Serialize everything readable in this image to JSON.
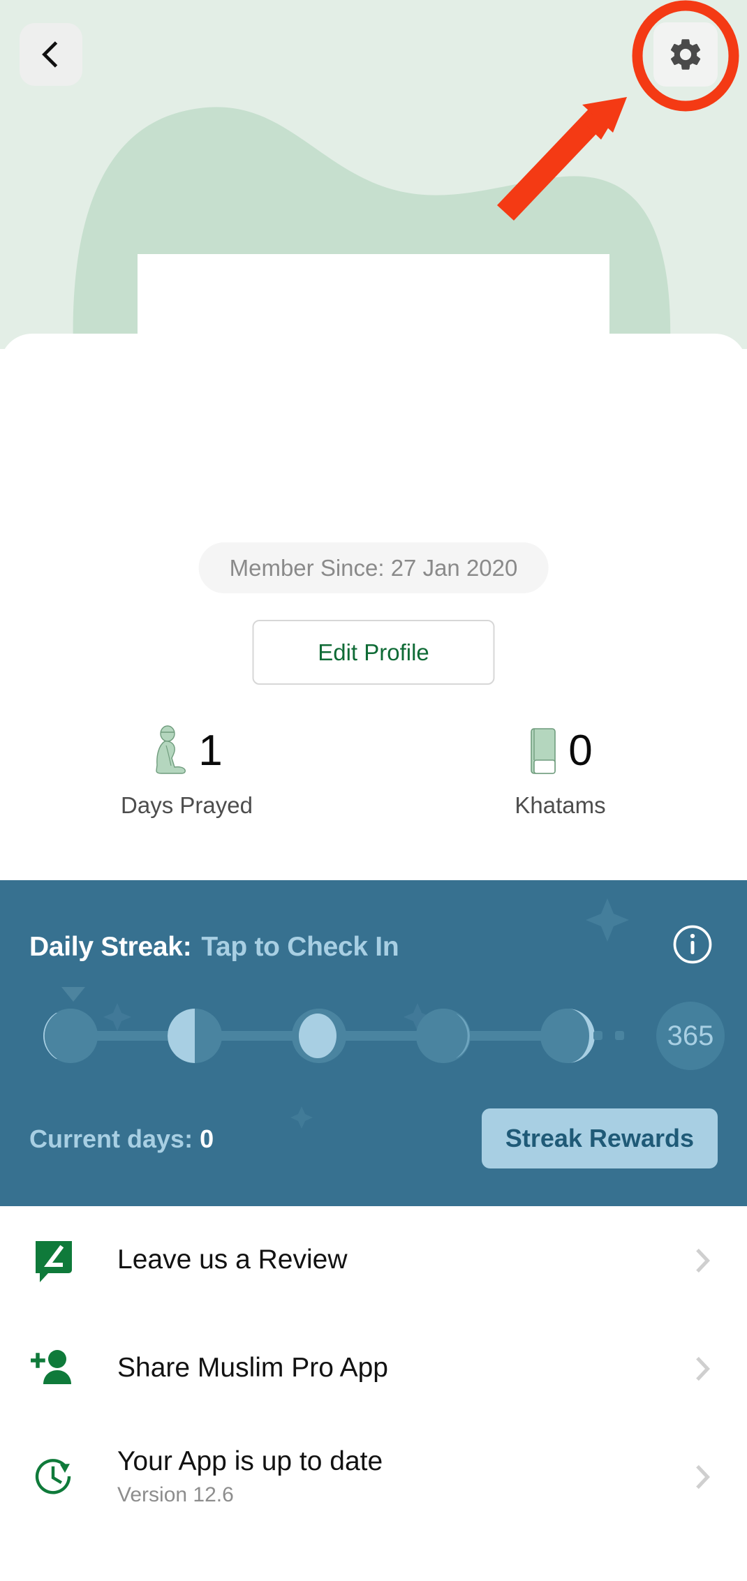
{
  "header": {
    "back_icon": "chevron-left-icon",
    "settings_icon": "gear-icon",
    "annotation": {
      "highlight_icon": "red-circle-annotation",
      "arrow_icon": "red-arrow-annotation",
      "color": "#f43a14"
    },
    "bg_color": "#e3eee6",
    "blob_color": "#c6dfce"
  },
  "profile": {
    "member_since": "Member Since: 27 Jan 2020",
    "edit_profile_label": "Edit Profile",
    "edit_profile_color": "#0f6b36"
  },
  "stats": [
    {
      "icon": "praying-person-icon",
      "value": "1",
      "label": "Days Prayed"
    },
    {
      "icon": "quran-book-icon",
      "value": "0",
      "label": "Khatams"
    }
  ],
  "streak": {
    "bg_color": "#377190",
    "title": "Daily Streak:",
    "action": "Tap to Check In",
    "info_icon": "info-circle-icon",
    "current_days_label": "Current days:",
    "current_days_value": "0",
    "rewards_label": "Streak Rewards",
    "milestone": "365",
    "accent_color": "#a8cfe3",
    "moons": [
      {
        "phase": "waxing-crescent",
        "name": "moon-phase-1-icon"
      },
      {
        "phase": "first-quarter",
        "name": "moon-phase-2-icon"
      },
      {
        "phase": "full",
        "name": "moon-phase-3-icon"
      },
      {
        "phase": "last-quarter-dim",
        "name": "moon-phase-4-icon"
      },
      {
        "phase": "waning-gibbous",
        "name": "moon-phase-5-icon"
      }
    ]
  },
  "menu": [
    {
      "icon": "review-speech-bubble-icon",
      "icon_color": "#0f7a3a",
      "title": "Leave us a Review",
      "subtitle": ""
    },
    {
      "icon": "person-add-icon",
      "icon_color": "#0f7a3a",
      "title": "Share Muslim Pro App",
      "subtitle": ""
    },
    {
      "icon": "update-clock-icon",
      "icon_color": "#0f7a3a",
      "title": "Your App is up to date",
      "subtitle": "Version 12.6"
    }
  ]
}
